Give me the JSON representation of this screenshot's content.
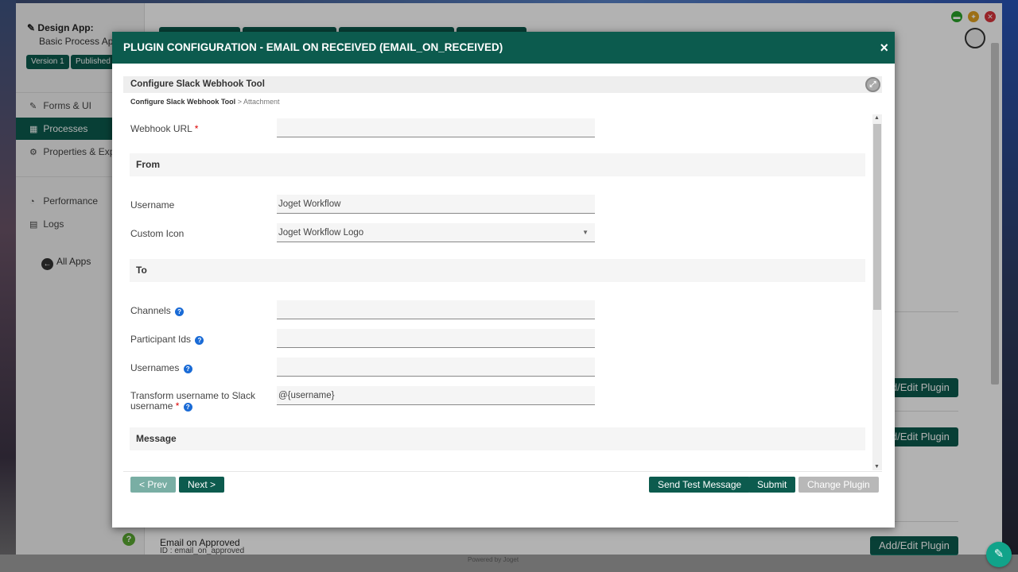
{
  "app": {
    "design_label": "Design App:",
    "app_name": "Basic Process App",
    "version_badge": "Version 1",
    "published_badge": "Published",
    "sidebar": [
      {
        "label": "Forms & UI",
        "icon": "edit-icon"
      },
      {
        "label": "Processes",
        "icon": "table-icon"
      },
      {
        "label": "Properties & Export",
        "icon": "gear-icon"
      },
      {
        "label": "Performance",
        "icon": "dashboard-icon"
      },
      {
        "label": "Logs",
        "icon": "log-icon"
      }
    ],
    "all_apps": "All Apps",
    "plugin_buttons": [
      "Add/Edit Plugin",
      "Add/Edit Plugin",
      "Add/Edit Plugin"
    ],
    "email_approved_title": "Email on Approved",
    "email_approved_id": "ID : email_on_approved",
    "powered_by": "Powered by Joget",
    "accent": "#0c5b4e"
  },
  "modal": {
    "title": "PLUGIN CONFIGURATION - EMAIL ON RECEIVED (EMAIL_ON_RECEIVED)",
    "close": "×",
    "config_title": "Configure Slack Webhook Tool",
    "breadcrumb_current": "Configure Slack Webhook Tool",
    "breadcrumb_sep": ">",
    "breadcrumb_next": "Attachment",
    "fields": {
      "webhook_url": {
        "label": "Webhook URL",
        "required": "*",
        "value": ""
      },
      "from_section": "From",
      "username": {
        "label": "Username",
        "value": "Joget Workflow"
      },
      "custom_icon": {
        "label": "Custom Icon",
        "value": "Joget Workflow Logo"
      },
      "to_section": "To",
      "channels": {
        "label": "Channels",
        "value": ""
      },
      "participant_ids": {
        "label": "Participant Ids",
        "value": ""
      },
      "usernames": {
        "label": "Usernames",
        "value": ""
      },
      "transform": {
        "label_line1": "Transform username to Slack",
        "label_line2": "username",
        "required": "*",
        "value": "@{username}"
      },
      "message_section": "Message"
    },
    "buttons": {
      "prev": "< Prev",
      "next": "Next >",
      "send_test": "Send Test Message",
      "submit": "Submit",
      "change_plugin": "Change Plugin"
    }
  }
}
